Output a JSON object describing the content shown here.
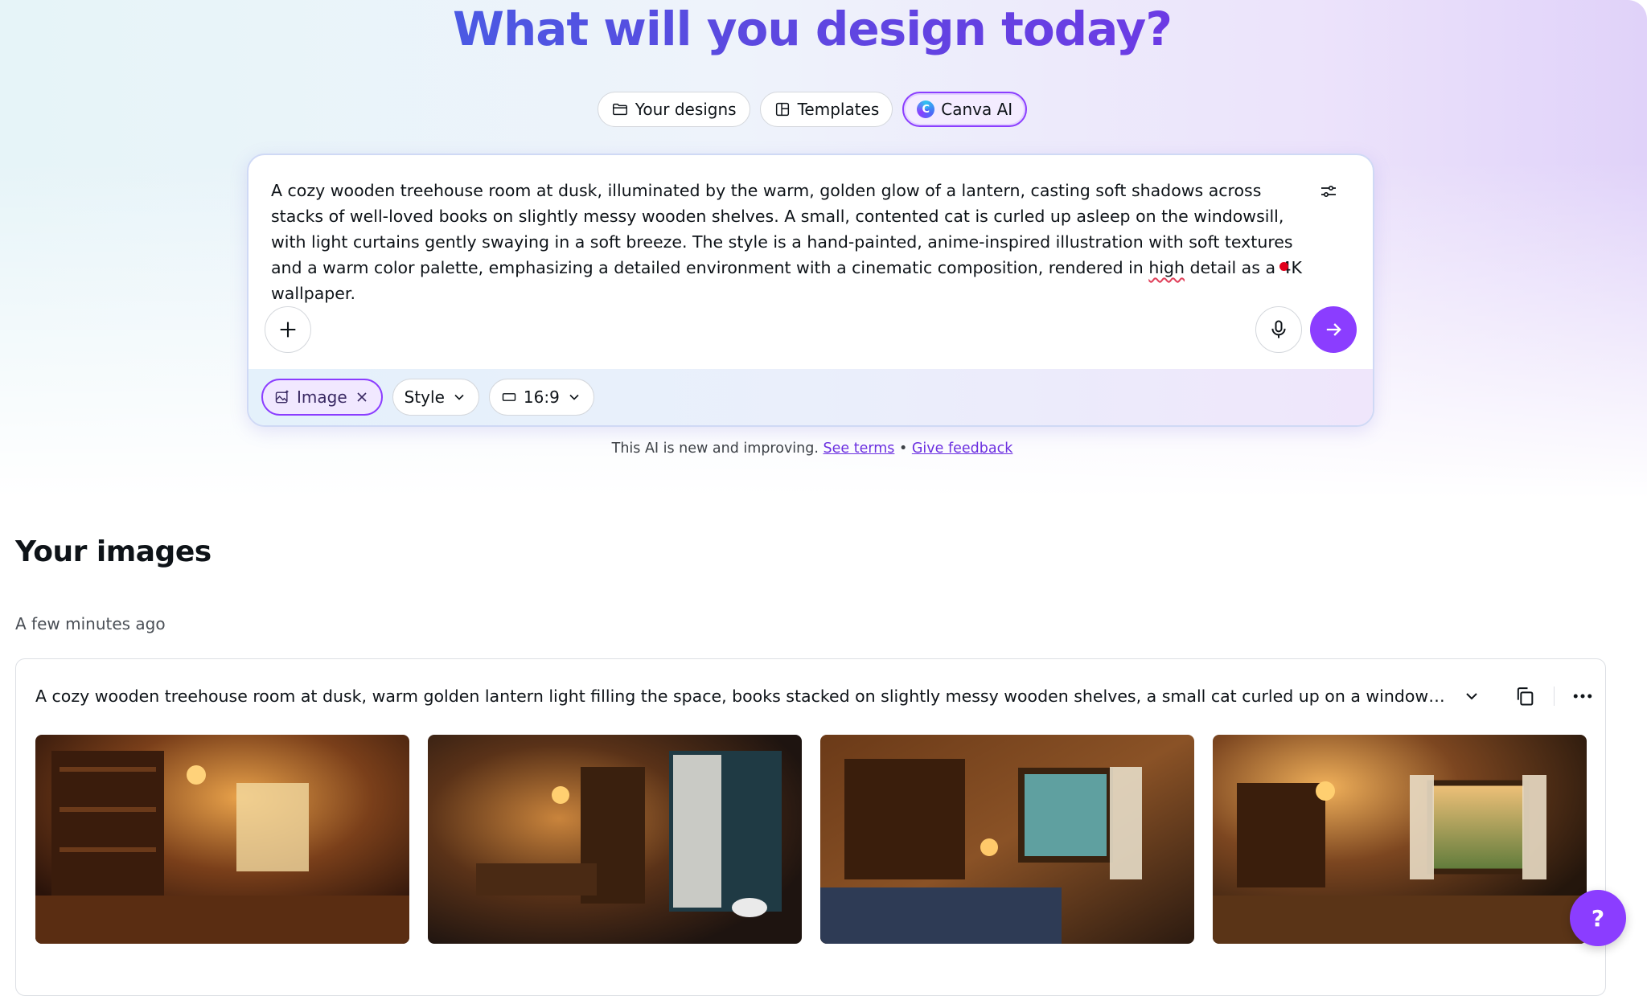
{
  "hero": {
    "title": "What will you design today?",
    "tabs": [
      {
        "label": "Your designs",
        "icon": "folder-icon"
      },
      {
        "label": "Templates",
        "icon": "template-icon"
      },
      {
        "label": "Canva AI",
        "icon": "canva-ai-icon",
        "active": true
      }
    ]
  },
  "composer": {
    "prompt_before": "A cozy wooden treehouse room at dusk, illuminated by the warm, golden glow of a lantern, casting soft shadows across stacks of well-loved books on slightly messy wooden shelves. A small, contented cat is curled up asleep on the windowsill, with light curtains gently swaying in a soft breeze. The style is a hand-painted, anime-inspired illustration with soft textures and a warm color palette, emphasizing a detailed environment with a cinematic composition, rendered in ",
    "prompt_spell": "high",
    "prompt_after": " detail as a 4K wallpaper.",
    "chips": {
      "image_label": "Image",
      "style_label": "Style",
      "ratio_label": "16:9"
    }
  },
  "disclaimer": {
    "text": "This AI is new and improving.",
    "see_terms": "See terms",
    "bullet": "•",
    "feedback": "Give feedback"
  },
  "images_section": {
    "title": "Your images",
    "time_label": "A few minutes ago",
    "card_prompt": "A cozy wooden treehouse room at dusk, warm golden lantern light filling the space, books stacked on slightly messy wooden shelves, a small cat curled up on a windowsill, soft ..."
  },
  "help": {
    "label": "?"
  },
  "colors": {
    "accent": "#8b3dff",
    "title_start": "#2f73e8",
    "title_end": "#7d2ae8"
  }
}
